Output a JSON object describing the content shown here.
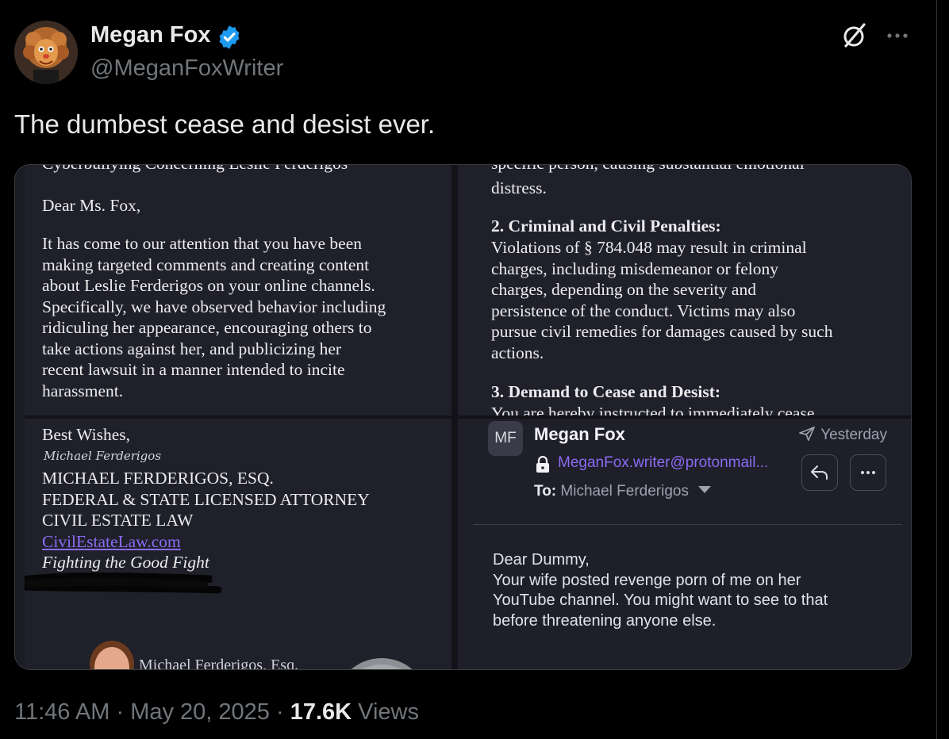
{
  "author": {
    "display_name": "Megan Fox",
    "handle": "@MeganFoxWriter"
  },
  "tweet": {
    "text": "The dumbest cease and desist ever."
  },
  "media": {
    "letter_left": {
      "cut_top": "Cyberbullying Concerning Leslie Ferderigos",
      "salutation": "Dear Ms. Fox,",
      "body_lines": [
        "It has come to our attention that you have been",
        "making targeted comments and creating content",
        "about Leslie Ferderigos on your online channels.",
        "Specifically, we have observed behavior including",
        "ridiculing her appearance, encouraging others to",
        "take actions against her, and publicizing her",
        "recent lawsuit in a manner intended to incite",
        "harassment."
      ],
      "closing": "Best Wishes,",
      "signature_script": "Michael Ferderigos",
      "sig_lines": [
        "MICHAEL FERDERIGOS, ESQ.",
        "FEDERAL & STATE LICENSED ATTORNEY",
        "CIVIL ESTATE LAW"
      ],
      "website": "CivilEstateLaw.com",
      "tagline": "Fighting the Good Fight",
      "footer_name": "Michael Ferderigos, Esq."
    },
    "letter_right": {
      "cut_top": "specific person, causing substantial emotional",
      "line_distress": "distress.",
      "section2_heading": "2. Criminal and Civil Penalties:",
      "section2_lines": [
        "Violations of § 784.048 may result in criminal",
        "charges, including misdemeanor or felony",
        "charges, depending on the severity and",
        "persistence of the conduct. Victims may also",
        "pursue civil remedies for damages caused by such",
        "actions."
      ],
      "section3_heading": "3. Demand to Cease and Desist:",
      "section3_cut": "You are hereby instructed to immediately cease"
    },
    "email": {
      "avatar_initials": "MF",
      "sender": "Megan Fox",
      "date": "Yesterday",
      "from_address": "MeganFox.writer@protonmail...",
      "to_label": "To:",
      "to_name": "Michael Ferderigos",
      "body_lines": [
        "Dear Dummy,",
        "Your wife posted revenge porn of me on her",
        "YouTube channel. You might want to see to that",
        "before threatening anyone else."
      ],
      "reply_icon": "reply-icon",
      "more_icon": "more-icon"
    }
  },
  "meta": {
    "time": "11:46 AM",
    "separator": "·",
    "date": "May 20, 2025",
    "views_count": "17.6K",
    "views_label": "Views"
  },
  "colors": {
    "background": "#000000",
    "text": "#e7e9ea",
    "muted": "#71767b",
    "verified": "#1d9bf0",
    "link_purple": "#8c6bf3"
  }
}
